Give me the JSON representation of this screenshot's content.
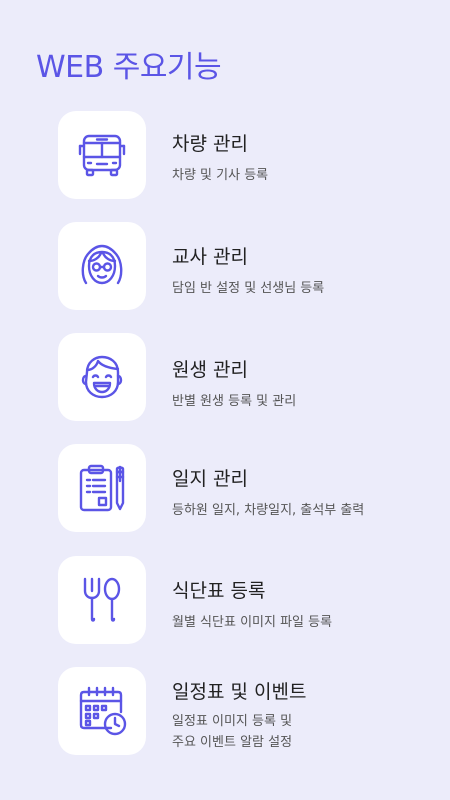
{
  "header": {
    "title": "WEB 주요기능"
  },
  "features": [
    {
      "icon": "bus-icon",
      "title": "차량 관리",
      "desc": [
        "차량 및 기사 등록"
      ]
    },
    {
      "icon": "teacher-face-icon",
      "title": "교사 관리",
      "desc": [
        "담임 반 설정 및 선생님 등록"
      ]
    },
    {
      "icon": "student-face-icon",
      "title": "원생 관리",
      "desc": [
        "반별 원생 등록 및 관리"
      ]
    },
    {
      "icon": "clipboard-pen-icon",
      "title": "일지 관리",
      "desc": [
        "등하원 일지, 차량일지, 출석부 출력"
      ]
    },
    {
      "icon": "fork-spoon-icon",
      "title": "식단표 등록",
      "desc": [
        "월별 식단표 이미지 파일 등록"
      ]
    },
    {
      "icon": "calendar-clock-icon",
      "title": "일정표 및 이벤트",
      "desc": [
        "일정표 이미지 등록 및",
        "주요 이벤트 알람 설정"
      ]
    }
  ]
}
